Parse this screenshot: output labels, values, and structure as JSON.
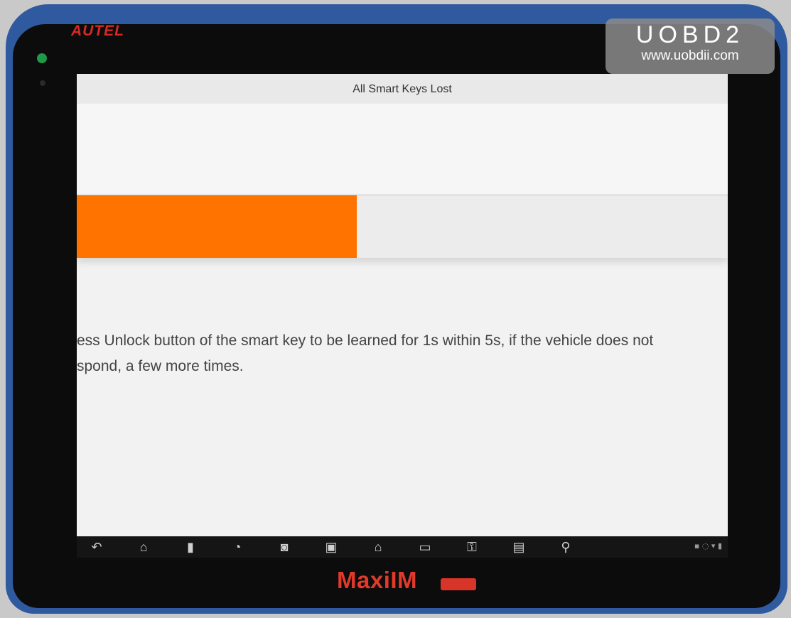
{
  "device": {
    "brand": "AUTEL",
    "model": "MaxiIM",
    "accent_color": "#ff7300",
    "brand_color": "#d42a25"
  },
  "watermark": {
    "title": "UOBD2",
    "url": "www.uobdii.com"
  },
  "screen": {
    "title": "All Smart Keys Lost",
    "progress": 0.43,
    "message": "ess Unlock button of the smart key to be learned for 1s within 5s, if the vehicle does not\nspond, a few more times."
  },
  "navbar": {
    "icons": [
      "back-icon",
      "home-icon",
      "recent-apps-icon",
      "browser-icon",
      "camera-icon",
      "screenshot-icon",
      "maxiim-home-icon",
      "vci-icon",
      "key-icon",
      "vehicle-icon",
      "remote-icon"
    ]
  }
}
